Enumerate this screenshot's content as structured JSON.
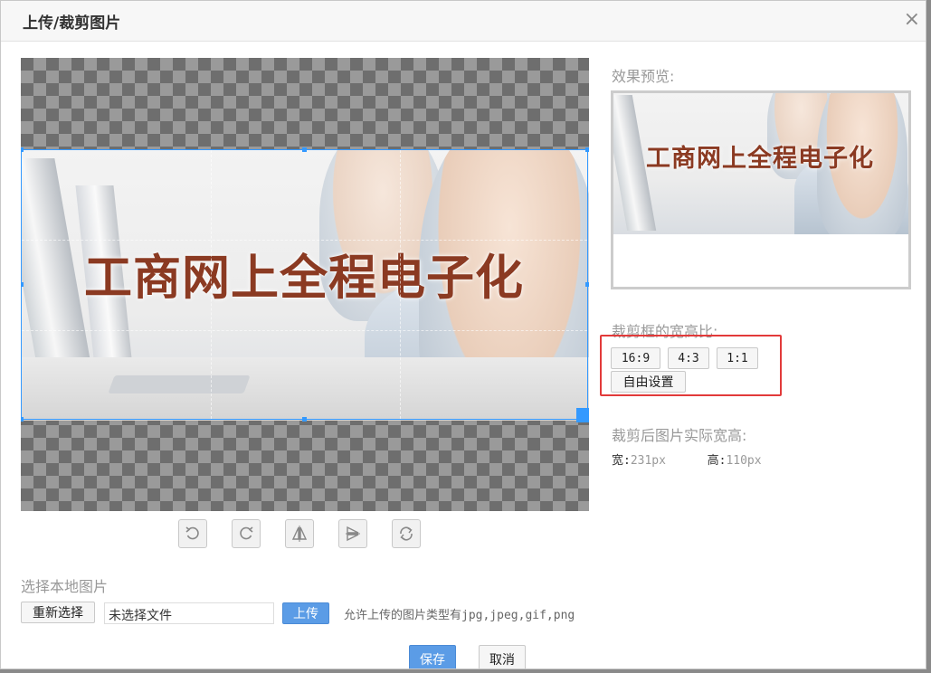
{
  "dialog": {
    "title": "上传/裁剪图片",
    "close_glyph": "×"
  },
  "image": {
    "banner_text": "工商网上全程电子化"
  },
  "toolbar": {
    "icons": [
      "rotate-left-icon",
      "rotate-right-icon",
      "flip-horizontal-icon",
      "flip-vertical-icon",
      "reset-icon"
    ]
  },
  "preview": {
    "label": "效果预览:"
  },
  "ratio": {
    "label": "裁剪框的宽高比:",
    "options": [
      "16:9",
      "4:3",
      "1:1",
      "自由设置"
    ]
  },
  "actual_size": {
    "label": "裁剪后图片实际宽高:",
    "width_label": "宽:",
    "width_value": "231px",
    "height_label": "高:",
    "height_value": "110px"
  },
  "local": {
    "label": "选择本地图片",
    "reselect_button": "重新选择",
    "file_value": "未选择文件",
    "upload_button": "上传",
    "hint": "允许上传的图片类型有jpg,jpeg,gif,png"
  },
  "footer": {
    "save_button": "保存",
    "cancel_button": "取消"
  },
  "colors": {
    "accent": "#3399ff",
    "primary_button": "#5b9ce6",
    "highlight_border": "#e23a3a",
    "banner_text": "#8b3a22"
  }
}
